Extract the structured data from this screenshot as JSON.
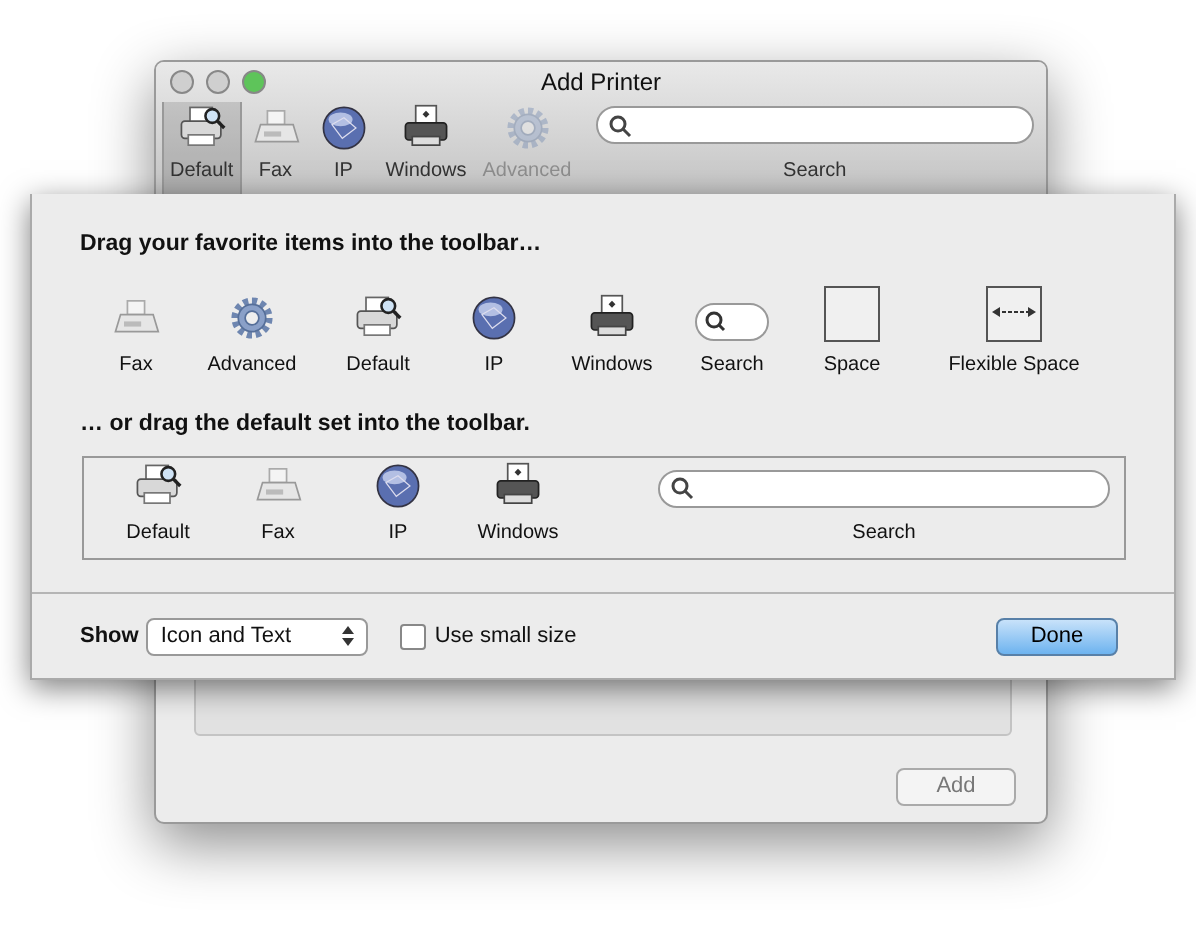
{
  "window": {
    "title": "Add Printer"
  },
  "toolbar": {
    "items": [
      {
        "label": "Default",
        "kind": "printer",
        "selected": true,
        "disabled": false
      },
      {
        "label": "Fax",
        "kind": "fax",
        "selected": false,
        "disabled": false
      },
      {
        "label": "IP",
        "kind": "globe",
        "selected": false,
        "disabled": false
      },
      {
        "label": "Windows",
        "kind": "windows",
        "selected": false,
        "disabled": false
      },
      {
        "label": "Advanced",
        "kind": "gear",
        "selected": false,
        "disabled": true
      },
      {
        "label": "Search",
        "kind": "search",
        "selected": false,
        "disabled": false
      }
    ]
  },
  "sheet": {
    "palette_heading": "Drag your favorite items into the toolbar…",
    "palette": [
      {
        "label": "Fax",
        "kind": "fax"
      },
      {
        "label": "Advanced",
        "kind": "gear"
      },
      {
        "label": "Default",
        "kind": "printer"
      },
      {
        "label": "IP",
        "kind": "globe"
      },
      {
        "label": "Windows",
        "kind": "windows"
      },
      {
        "label": "Search",
        "kind": "searchsmall"
      },
      {
        "label": "Space",
        "kind": "space"
      },
      {
        "label": "Flexible Space",
        "kind": "flexspace"
      }
    ],
    "default_heading": "… or drag the default set into the toolbar.",
    "default_set": [
      {
        "label": "Default",
        "kind": "printer"
      },
      {
        "label": "Fax",
        "kind": "fax"
      },
      {
        "label": "IP",
        "kind": "globe"
      },
      {
        "label": "Windows",
        "kind": "windows"
      },
      {
        "label": "Search",
        "kind": "search"
      }
    ],
    "show_label": "Show",
    "show_value": "Icon and Text",
    "small_size": {
      "label": "Use small size",
      "checked": false
    },
    "done": "Done"
  },
  "add_button": {
    "label": "Add",
    "disabled": true
  }
}
